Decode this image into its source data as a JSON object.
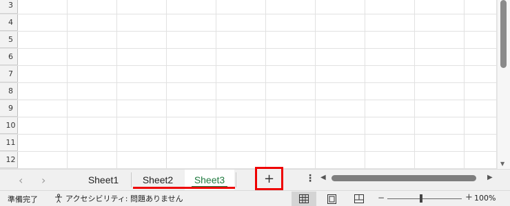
{
  "rows": [
    "3",
    "4",
    "5",
    "6",
    "7",
    "8",
    "9",
    "10",
    "11",
    "12"
  ],
  "sheets": [
    {
      "label": "Sheet1",
      "active": false
    },
    {
      "label": "Sheet2",
      "active": false
    },
    {
      "label": "Sheet3",
      "active": true
    }
  ],
  "add_sheet_label": "+",
  "more_label": "⋮",
  "status": {
    "ready": "準備完了",
    "accessibility": "アクセシビリティ: 問題ありません"
  },
  "zoom": {
    "minus": "−",
    "plus": "+",
    "level": "100%"
  },
  "colors": {
    "highlight": "#ee0000",
    "active_tab": "#1f7a3f"
  },
  "icons": {
    "nav_left": "chevron-left-icon",
    "nav_right": "chevron-right-icon",
    "normal_view": "grid-view-icon",
    "page_layout": "page-layout-icon",
    "page_break": "page-break-preview-icon",
    "accessibility": "accessibility-icon"
  }
}
